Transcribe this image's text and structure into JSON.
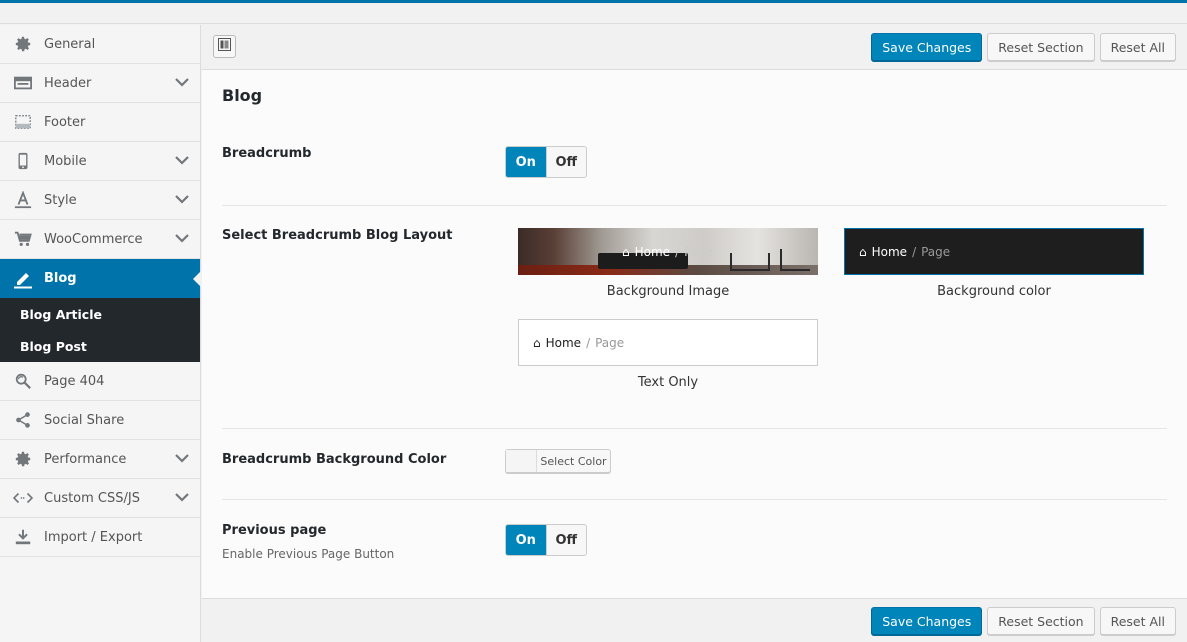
{
  "sidebar": {
    "items": [
      {
        "label": "General",
        "icon": "gear-icon",
        "expandable": false
      },
      {
        "label": "Header",
        "icon": "header-layout-icon",
        "expandable": true
      },
      {
        "label": "Footer",
        "icon": "footer-grid-icon",
        "expandable": false
      },
      {
        "label": "Mobile",
        "icon": "mobile-icon",
        "expandable": true
      },
      {
        "label": "Style",
        "icon": "text-style-icon",
        "expandable": true
      },
      {
        "label": "WooCommerce",
        "icon": "cart-icon",
        "expandable": true
      },
      {
        "label": "Blog",
        "icon": "edit-pen-icon",
        "expandable": false,
        "active": true
      },
      {
        "label": "Page 404",
        "icon": "search-refresh-icon",
        "expandable": false
      },
      {
        "label": "Social Share",
        "icon": "share-icon",
        "expandable": false
      },
      {
        "label": "Performance",
        "icon": "gear-icon",
        "expandable": true
      },
      {
        "label": "Custom CSS/JS",
        "icon": "code-icon",
        "expandable": true
      },
      {
        "label": "Import / Export",
        "icon": "download-icon",
        "expandable": false
      }
    ],
    "blog_subitems": [
      "Blog Article",
      "Blog Post"
    ]
  },
  "toolbar": {
    "save_label": "Save Changes",
    "reset_section_label": "Reset Section",
    "reset_all_label": "Reset All"
  },
  "section": {
    "title": "Blog"
  },
  "fields": {
    "breadcrumb": {
      "label": "Breadcrumb",
      "on": "On",
      "off": "Off",
      "value": "On"
    },
    "layout": {
      "label": "Select Breadcrumb Blog Layout",
      "crumb_home": "Home",
      "crumb_sep": "/",
      "crumb_page": "Page",
      "options": [
        "Background Image",
        "Background color",
        "Text Only"
      ],
      "selected": "Background color"
    },
    "bg_color": {
      "label": "Breadcrumb Background Color",
      "button": "Select Color"
    },
    "previous_page": {
      "label": "Previous page",
      "description": "Enable Previous Page Button",
      "on": "On",
      "off": "Off",
      "value": "On"
    }
  },
  "colors": {
    "accent": "#0073aa",
    "primary_button": "#0085ba",
    "submenu_bg": "#23282d"
  }
}
